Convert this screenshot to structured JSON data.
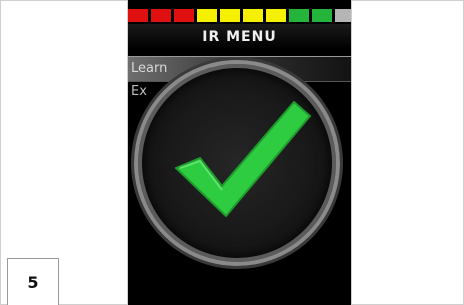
{
  "step": {
    "number": "5"
  },
  "screen": {
    "title": "IR MENU",
    "menu_items": [
      {
        "label": "Learn",
        "selected": true
      },
      {
        "label": "Ex",
        "selected": false
      }
    ],
    "level_colors": [
      "#e01010",
      "#e01010",
      "#e01010",
      "#f5f000",
      "#f5f000",
      "#f5f000",
      "#f5f000",
      "#24b43c",
      "#24b43c",
      "#b5b5b5"
    ],
    "confirmation_icon": "check-mark-icon"
  },
  "colors": {
    "check": "#2ecc40",
    "screen_bg": "#000000"
  }
}
